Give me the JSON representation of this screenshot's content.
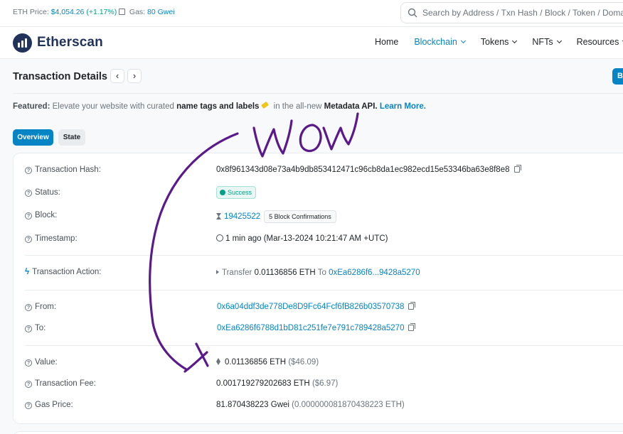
{
  "topbar": {
    "eth_price_label": "ETH Price:",
    "eth_price_value": "$4,054.26",
    "eth_price_change": "(+1.17%)",
    "gas_label": "Gas:",
    "gas_value": "80 Gwei"
  },
  "search": {
    "placeholder": "Search by Address / Txn Hash / Block / Token / Domain Name"
  },
  "brand": {
    "name": "Etherscan"
  },
  "nav": {
    "home": "Home",
    "blockchain": "Blockchain",
    "tokens": "Tokens",
    "nfts": "NFTs",
    "resources": "Resources"
  },
  "page": {
    "title": "Transaction Details",
    "prev": "‹",
    "next": "›",
    "buy_button": "Bu"
  },
  "featured": {
    "label": "Featured:",
    "text1": "Elevate your website with curated",
    "bold1": "name tags and labels",
    "text2": "in the all-new",
    "bold2": "Metadata API.",
    "link": "Learn More."
  },
  "tabs": {
    "overview": "Overview",
    "state": "State"
  },
  "details": {
    "tx_hash": {
      "label": "Transaction Hash:",
      "value": "0x8f961343d08e73a4b9db853412471c96cb8da1ec982ecd15e53346ba63e8f8e8"
    },
    "status": {
      "label": "Status:",
      "value": "Success"
    },
    "block": {
      "label": "Block:",
      "value": "19425522",
      "confirmations": "5 Block Confirmations"
    },
    "timestamp": {
      "label": "Timestamp:",
      "value": "1 min ago (Mar-13-2024 10:21:47 AM +UTC)"
    },
    "action": {
      "label": "Transaction Action:",
      "verb": "Transfer",
      "amount": "0.01136856 ETH",
      "to_word": "To",
      "to_addr": "0xEa6286f6...9428a5270"
    },
    "from": {
      "label": "From:",
      "value": "0x6a04ddf3de778De8D9Fc64Fcf6fB826b03570738"
    },
    "to": {
      "label": "To:",
      "value": "0xEa6286f6788d1bD81c251fe7e791c789428a5270"
    },
    "value": {
      "label": "Value:",
      "amount": "0.01136856 ETH",
      "usd": "($46.09)"
    },
    "fee": {
      "label": "Transaction Fee:",
      "amount": "0.001719279202683 ETH",
      "usd": "($6.97)"
    },
    "gas_price": {
      "label": "Gas Price:",
      "amount": "81.870438223 Gwei",
      "eth": "(0.000000081870438223 ETH)"
    }
  },
  "annotation": {
    "text": "WOW",
    "color": "#5b1a8b"
  },
  "colors": {
    "accent": "#0784c3",
    "brand": "#21325b",
    "success": "#00a186"
  }
}
